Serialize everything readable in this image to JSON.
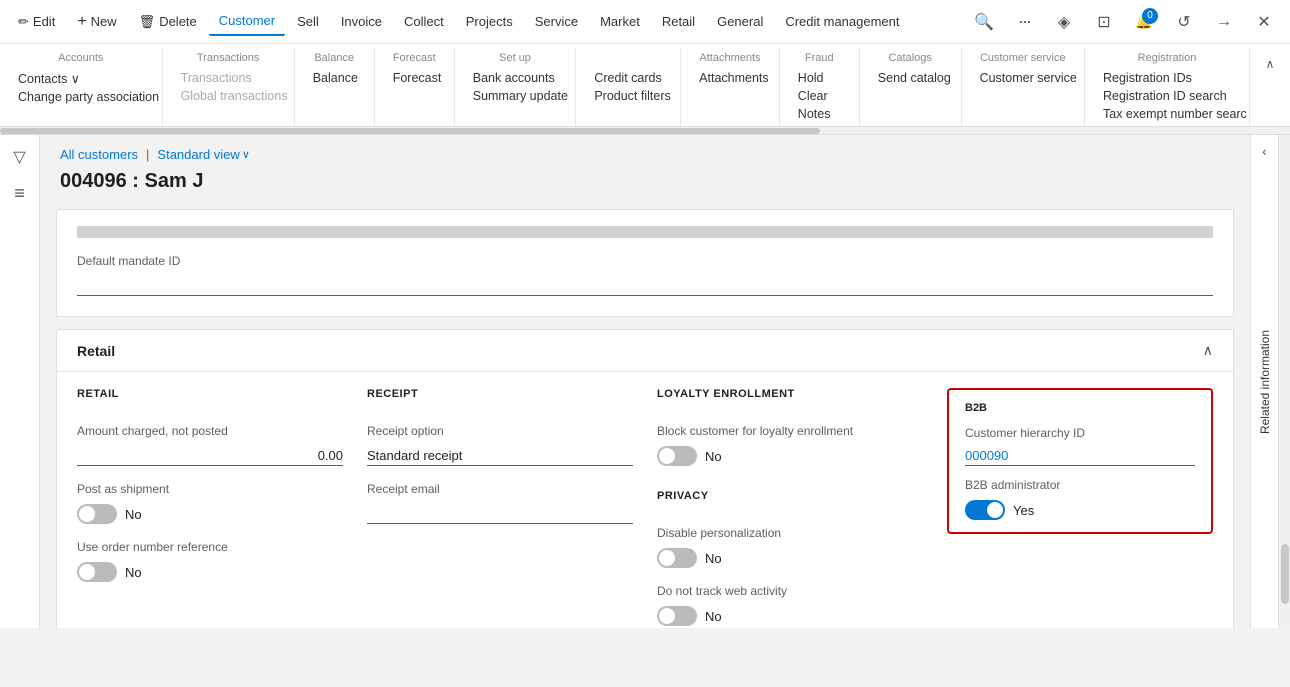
{
  "topnav": {
    "items": [
      {
        "label": "Edit",
        "icon": "✏️",
        "active": false
      },
      {
        "label": "New",
        "icon": "+",
        "active": false
      },
      {
        "label": "Delete",
        "icon": "🗑",
        "active": false
      },
      {
        "label": "Customer",
        "icon": "",
        "active": true
      },
      {
        "label": "Sell",
        "icon": "",
        "active": false
      },
      {
        "label": "Invoice",
        "icon": "",
        "active": false
      },
      {
        "label": "Collect",
        "icon": "",
        "active": false
      },
      {
        "label": "Projects",
        "icon": "",
        "active": false
      },
      {
        "label": "Service",
        "icon": "",
        "active": false
      },
      {
        "label": "Market",
        "icon": "",
        "active": false
      },
      {
        "label": "Retail",
        "icon": "",
        "active": false
      },
      {
        "label": "General",
        "icon": "",
        "active": false
      },
      {
        "label": "Credit management",
        "icon": "",
        "active": false
      }
    ],
    "right_icons": [
      "🔍",
      "···",
      "◇",
      "◫",
      "0",
      "↺",
      "→",
      "✕"
    ]
  },
  "ribbon": {
    "groups": [
      {
        "title": "Accounts",
        "items": [
          {
            "label": "Contacts ∨",
            "disabled": false
          },
          {
            "label": "Change party association",
            "disabled": false
          }
        ]
      },
      {
        "title": "Transactions",
        "items": [
          {
            "label": "Transactions",
            "disabled": true
          },
          {
            "label": "Global transactions",
            "disabled": true
          }
        ]
      },
      {
        "title": "Balance",
        "items": [
          {
            "label": "Balance",
            "disabled": false
          }
        ]
      },
      {
        "title": "Forecast",
        "items": [
          {
            "label": "Forecast",
            "disabled": false
          }
        ]
      },
      {
        "title": "Set up",
        "items": [
          {
            "label": "Bank accounts",
            "disabled": false
          },
          {
            "label": "Summary update",
            "disabled": false
          }
        ]
      },
      {
        "title": "",
        "items": [
          {
            "label": "Credit cards",
            "disabled": false
          },
          {
            "label": "Product filters",
            "disabled": false
          }
        ]
      },
      {
        "title": "Attachments",
        "items": [
          {
            "label": "Attachments",
            "disabled": false
          }
        ]
      },
      {
        "title": "Fraud",
        "items": [
          {
            "label": "Hold",
            "disabled": false
          },
          {
            "label": "Clear",
            "disabled": false
          },
          {
            "label": "Notes",
            "disabled": false
          }
        ]
      },
      {
        "title": "Catalogs",
        "items": [
          {
            "label": "Send catalog",
            "disabled": false
          }
        ]
      },
      {
        "title": "Customer service",
        "items": [
          {
            "label": "Customer service",
            "disabled": false
          }
        ]
      },
      {
        "title": "Registration",
        "items": [
          {
            "label": "Registration IDs",
            "disabled": false
          },
          {
            "label": "Registration ID search",
            "disabled": false
          },
          {
            "label": "Tax exempt number searc",
            "disabled": false
          }
        ]
      }
    ]
  },
  "breadcrumb": {
    "link": "All customers",
    "separator": "|",
    "view": "Standard view"
  },
  "page": {
    "title": "004096 : Sam J"
  },
  "retail_section": {
    "title": "Retail",
    "retail_col": {
      "heading": "RETAIL",
      "amount_label": "Amount charged, not posted",
      "amount_value": "0.00",
      "post_as_shipment_label": "Post as shipment",
      "post_as_shipment_toggle": false,
      "post_as_shipment_text": "No",
      "use_order_label": "Use order number reference",
      "use_order_toggle": false,
      "use_order_text": "No"
    },
    "receipt_col": {
      "heading": "RECEIPT",
      "receipt_option_label": "Receipt option",
      "receipt_option_value": "Standard receipt",
      "receipt_email_label": "Receipt email",
      "receipt_email_value": ""
    },
    "loyalty_col": {
      "heading": "LOYALTY ENROLLMENT",
      "block_label": "Block customer for loyalty enrollment",
      "block_toggle": false,
      "block_text": "No",
      "privacy_heading": "PRIVACY",
      "disable_label": "Disable personalization",
      "disable_toggle": false,
      "disable_text": "No",
      "track_label": "Do not track web activity",
      "track_toggle": false,
      "track_text": "No"
    },
    "b2b_col": {
      "heading": "B2B",
      "hierarchy_label": "Customer hierarchy ID",
      "hierarchy_value": "000090",
      "admin_label": "B2B administrator",
      "admin_toggle": true,
      "admin_text": "Yes"
    }
  },
  "mandate": {
    "label": "Default mandate ID",
    "value": ""
  },
  "icons": {
    "filter": "▽",
    "hamburger": "≡",
    "chevron_down": "∨",
    "chevron_up": "∧",
    "close": "✕",
    "search": "🔍",
    "refresh": "↺",
    "forward": "→",
    "settings": "⚙"
  }
}
